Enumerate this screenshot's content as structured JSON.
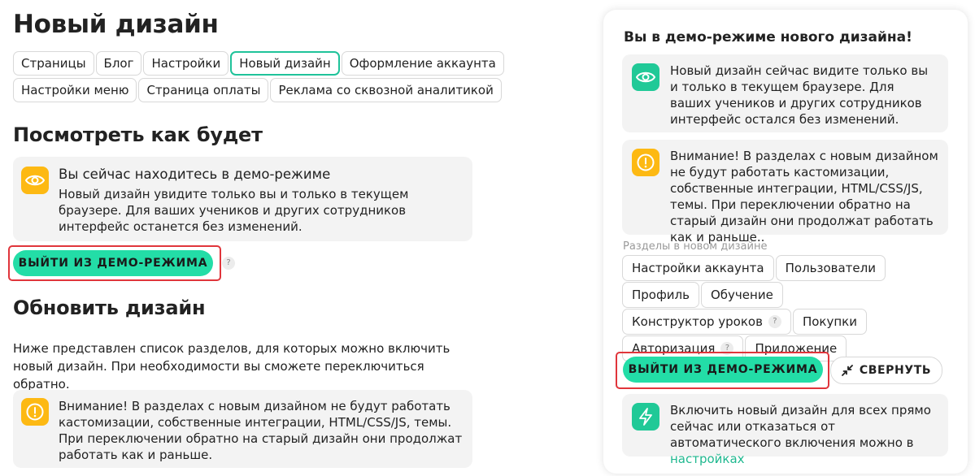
{
  "page": {
    "title": "Новый дизайн"
  },
  "tabs": [
    {
      "label": "Страницы"
    },
    {
      "label": "Блог"
    },
    {
      "label": "Настройки"
    },
    {
      "label": "Новый дизайн",
      "active": true
    },
    {
      "label": "Оформление аккаунта"
    },
    {
      "label": "Настройки меню"
    },
    {
      "label": "Страница оплаты"
    },
    {
      "label": "Реклама со сквозной аналитикой"
    }
  ],
  "preview": {
    "heading": "Посмотреть как будет",
    "demo_card": {
      "icon": "eye-icon",
      "title": "Вы сейчас находитесь в демо-режиме",
      "text": "Новый дизайн увидите только вы и только в текущем браузере. Для ваших учеников и других сотрудников интерфейс останется без изменений."
    },
    "exit_button": "ВЫЙТИ ИЗ ДЕМО-РЕЖИМА",
    "help": "?"
  },
  "update": {
    "heading": "Обновить дизайн",
    "description": "Ниже представлен список разделов, для которых можно включить новый дизайн. При необходимости вы сможете переключиться обратно.",
    "warning_card": {
      "icon": "warning-icon",
      "text": "Внимание! В разделах с новым дизайном не будут работать кастомизации, собственные интеграции, HTML/CSS/JS, темы. При переключении обратно на старый дизайн они продолжат работать как и раньше."
    }
  },
  "panel": {
    "title": "Вы в демо-режиме нового дизайна!",
    "info_card": {
      "icon": "eye-icon",
      "text": "Новый дизайн сейчас видите только вы и только в текущем браузере. Для ваших учеников и других сотрудников интерфейс остался без изменений."
    },
    "warning_card": {
      "icon": "warning-icon",
      "text": "Внимание! В разделах с новым дизайном не будут работать кастомизации, собственные интеграции, HTML/CSS/JS, темы. При переключении обратно на старый дизайн они продолжат работать как и раньше.."
    },
    "sections_label": "Разделы в новом дизайне",
    "sections": [
      {
        "label": "Настройки аккаунта"
      },
      {
        "label": "Пользователи"
      },
      {
        "label": "Профиль"
      },
      {
        "label": "Обучение"
      },
      {
        "label": "Конструктор уроков",
        "help": "?"
      },
      {
        "label": "Покупки"
      },
      {
        "label": "Авторизация",
        "help": "?"
      },
      {
        "label": "Приложение"
      }
    ],
    "exit_button": "ВЫЙТИ ИЗ ДЕМО-РЕЖИМА",
    "collapse_button": "СВЕРНУТЬ",
    "enable_card": {
      "icon": "lightning-icon",
      "text": "Включить новый дизайн для всех прямо сейчас или отказаться от автоматического включения можно в ",
      "link": "настройках"
    }
  },
  "colors": {
    "accent": "#23dda7",
    "warning": "#fdb913",
    "highlight": "#e0353b",
    "link": "#1fb88f"
  }
}
